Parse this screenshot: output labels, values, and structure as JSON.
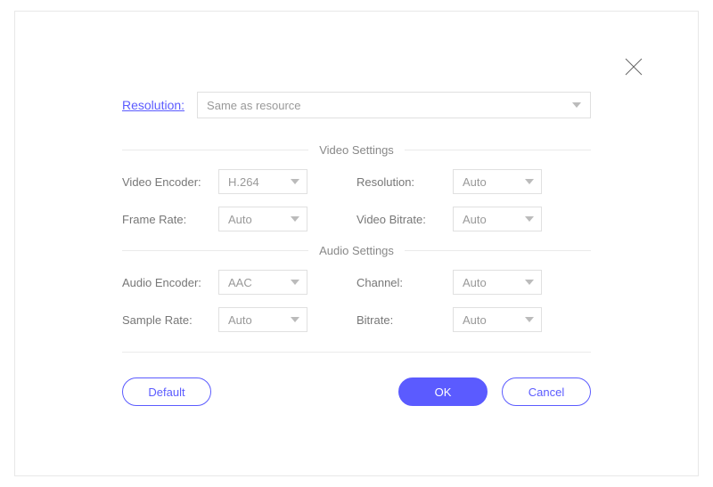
{
  "top": {
    "resolution_label": "Resolution:",
    "resolution_value": "Same as resource"
  },
  "video_section": {
    "title": "Video Settings",
    "encoder_label": "Video Encoder:",
    "encoder_value": "H.264",
    "resolution_label": "Resolution:",
    "resolution_value": "Auto",
    "framerate_label": "Frame Rate:",
    "framerate_value": "Auto",
    "bitrate_label": "Video Bitrate:",
    "bitrate_value": "Auto"
  },
  "audio_section": {
    "title": "Audio Settings",
    "encoder_label": "Audio Encoder:",
    "encoder_value": "AAC",
    "channel_label": "Channel:",
    "channel_value": "Auto",
    "samplerate_label": "Sample Rate:",
    "samplerate_value": "Auto",
    "bitrate_label": "Bitrate:",
    "bitrate_value": "Auto"
  },
  "buttons": {
    "default": "Default",
    "ok": "OK",
    "cancel": "Cancel"
  }
}
